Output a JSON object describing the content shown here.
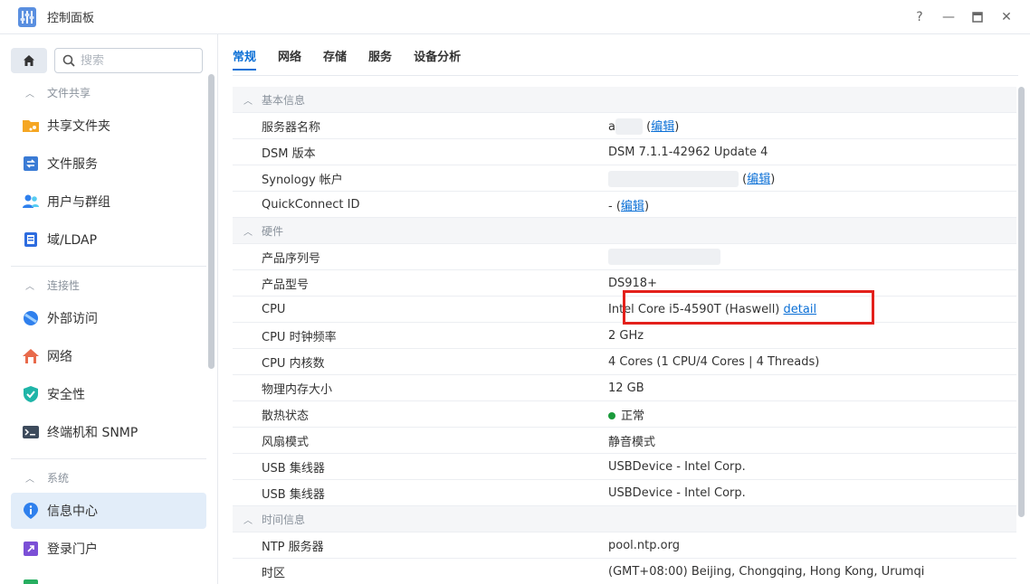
{
  "window": {
    "title": "控制面板",
    "controls": {
      "help": "?",
      "minimize": "—",
      "maximize": "▣",
      "close": "✕"
    }
  },
  "sidebar": {
    "search_placeholder": "搜索",
    "sections": {
      "file_sharing": "文件共享",
      "connectivity": "连接性",
      "system": "系统"
    },
    "items": {
      "shared_folder": "共享文件夹",
      "file_services": "文件服务",
      "user_group": "用户与群组",
      "domain_ldap": "域/LDAP",
      "external_access": "外部访问",
      "network": "网络",
      "security": "安全性",
      "terminal_snmp": "终端机和 SNMP",
      "info_center": "信息中心",
      "login_portal": "登录门户"
    }
  },
  "tabs": [
    "常规",
    "网络",
    "存储",
    "服务",
    "设备分析"
  ],
  "info": {
    "basic_header": "基本信息",
    "server_name_label": "服务器名称",
    "server_name_value": "a",
    "edit_label": "编辑",
    "dsm_label": "DSM 版本",
    "dsm_value": "DSM 7.1.1-42962 Update 4",
    "synology_label": "Synology 帐户",
    "quickconnect_label": "QuickConnect ID",
    "quickconnect_value": "-",
    "hardware_header": "硬件",
    "serial_label": "产品序列号",
    "model_label": "产品型号",
    "model_value": "DS918+",
    "cpu_label": "CPU",
    "cpu_value": "Intel Core i5-4590T (Haswell)",
    "cpu_detail": "detail",
    "cpu_clock_label": "CPU 时钟频率",
    "cpu_clock_value": "2 GHz",
    "cpu_cores_label": "CPU 内核数",
    "cpu_cores_value": "4 Cores (1 CPU/4 Cores | 4 Threads)",
    "memory_label": "物理内存大小",
    "memory_value": "12 GB",
    "thermal_label": "散热状态",
    "thermal_value": "正常",
    "fan_label": "风扇模式",
    "fan_value": "静音模式",
    "usb1_label": "USB 集线器",
    "usb1_value": "USBDevice - Intel Corp.",
    "usb2_label": "USB 集线器",
    "usb2_value": "USBDevice - Intel Corp.",
    "time_header": "时间信息",
    "ntp_label": "NTP 服务器",
    "ntp_value": "pool.ntp.org",
    "timezone_label": "时区",
    "timezone_value": "(GMT+08:00) Beijing, Chongqing, Hong Kong, Urumqi"
  },
  "colors": {
    "accent": "#0a6fd6",
    "highlight": "#e3201b",
    "ok": "#1a9a3b"
  }
}
